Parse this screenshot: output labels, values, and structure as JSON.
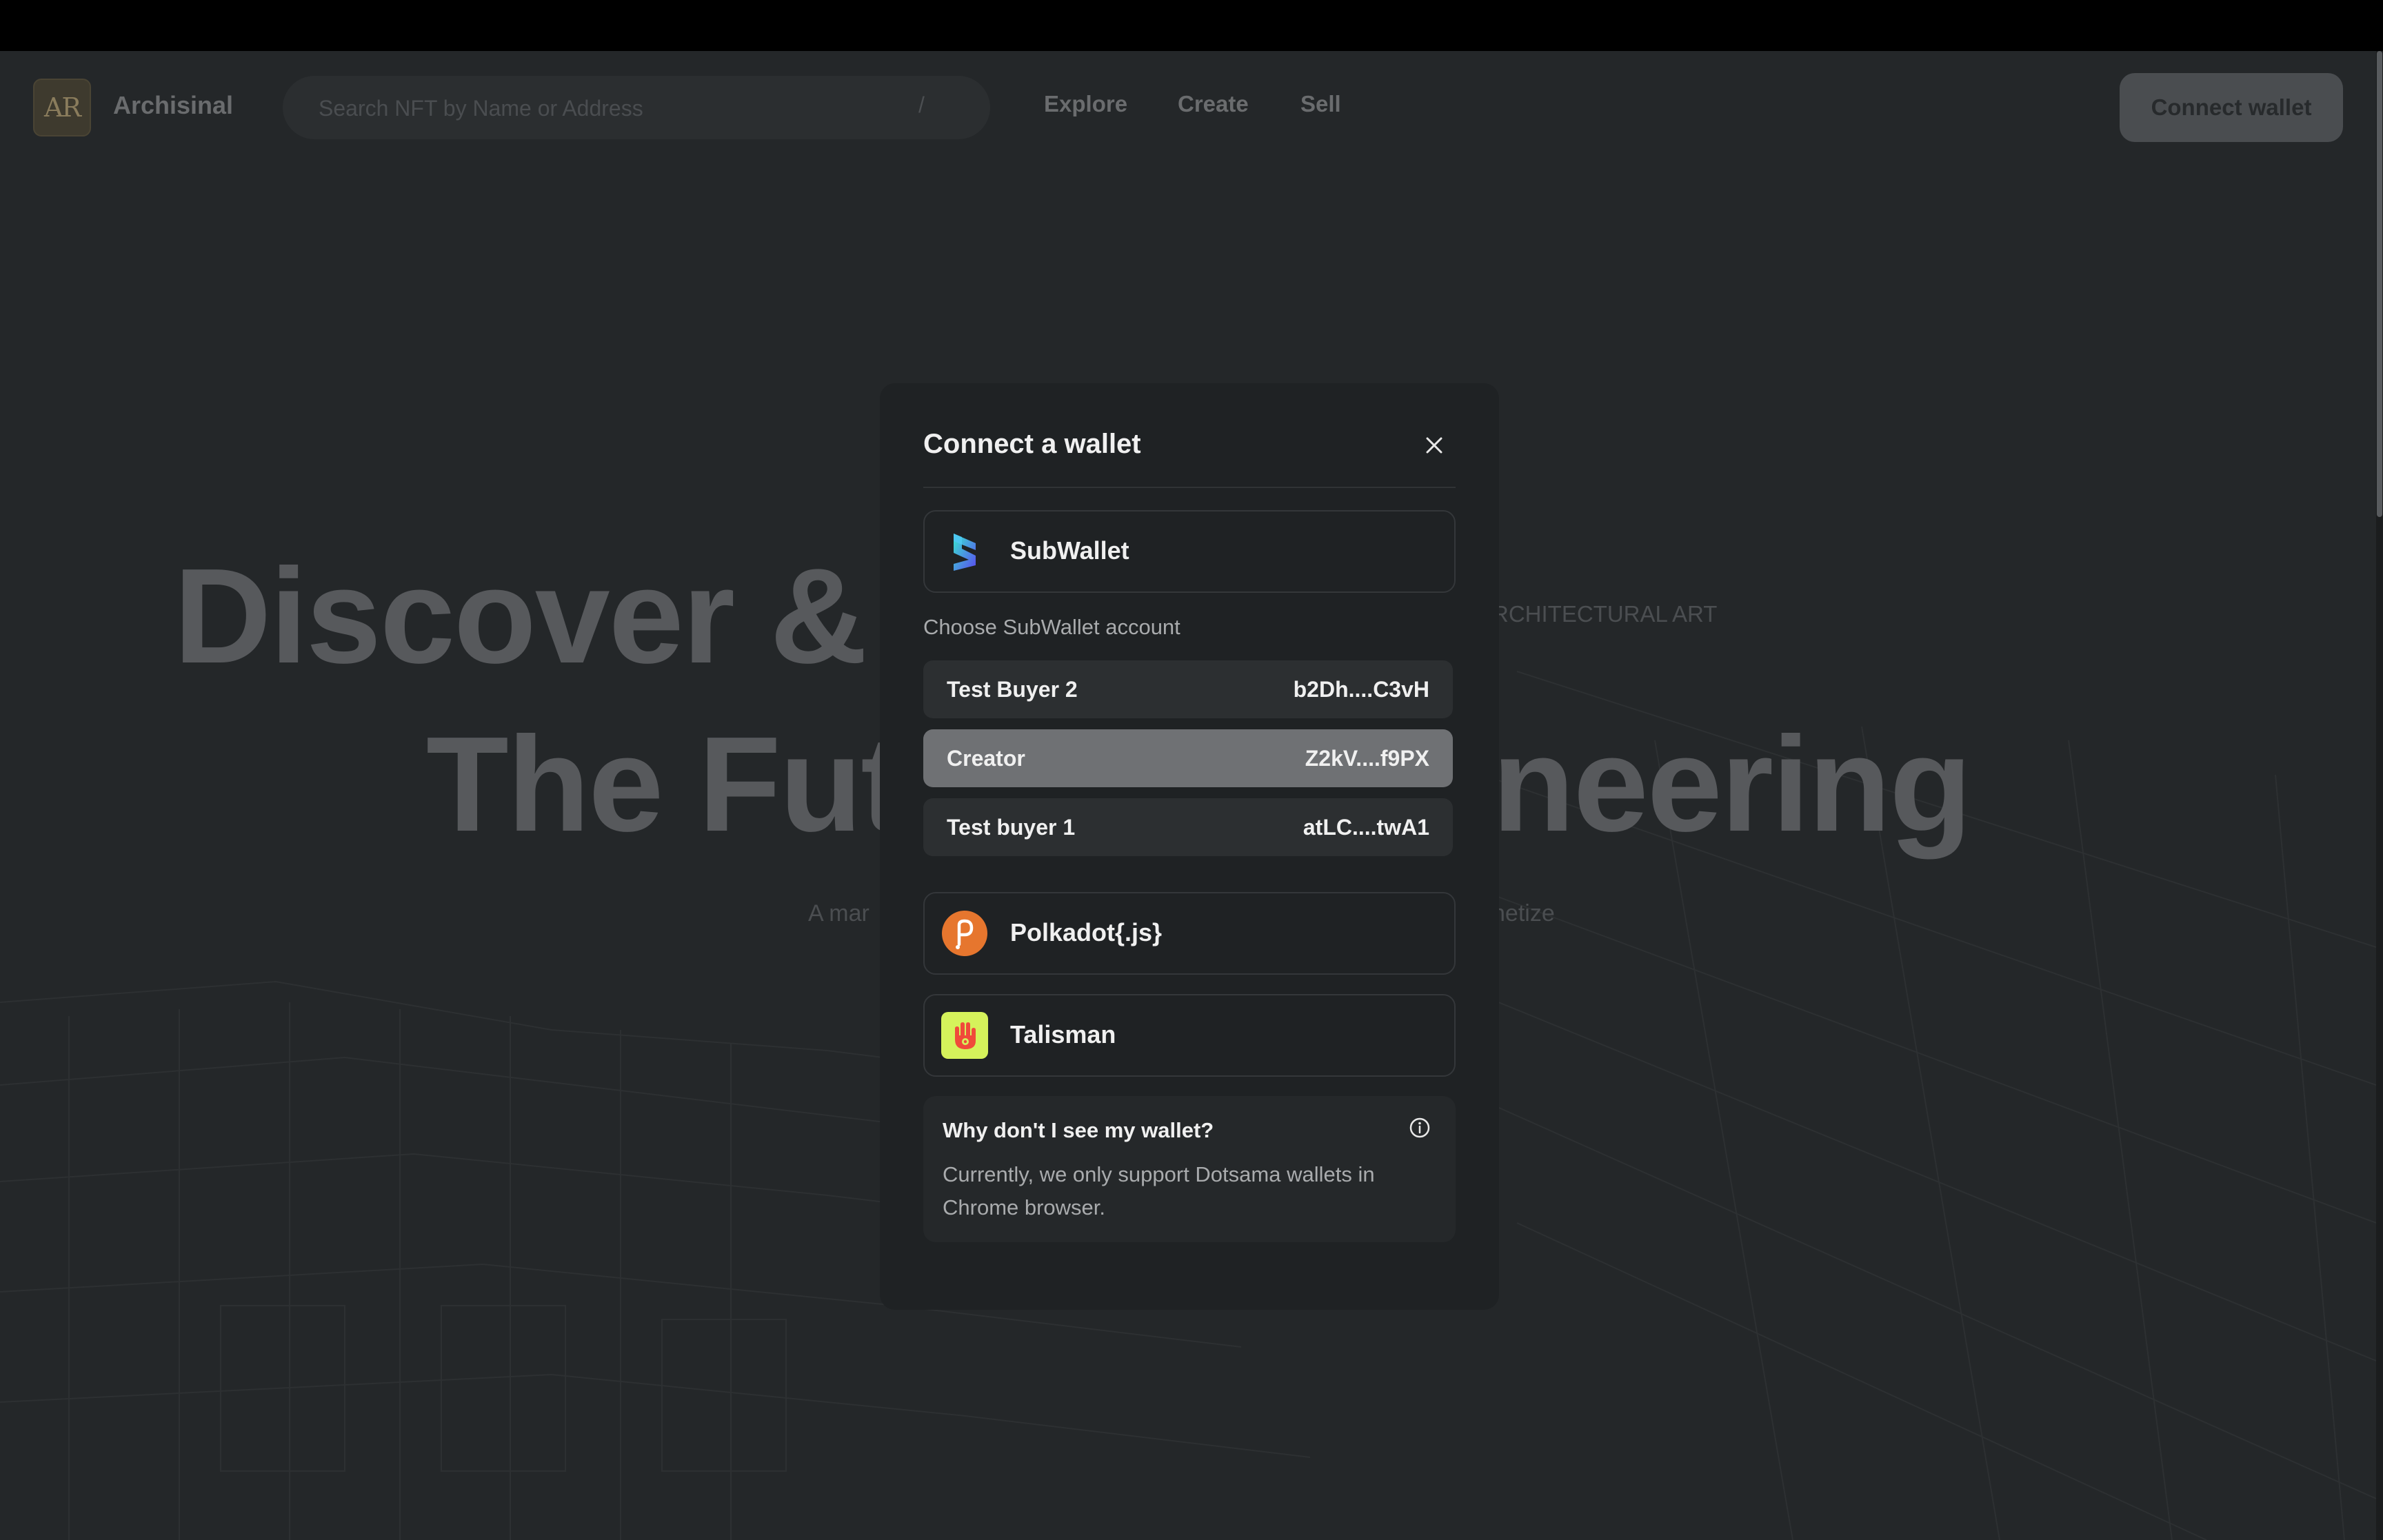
{
  "header": {
    "logo_text": "AR",
    "brand": "Archisinal",
    "search_placeholder": "Search NFT by Name or Address",
    "search_shortcut": "/",
    "nav": [
      "Explore",
      "Create",
      "Sell"
    ],
    "connect_button": "Connect wallet"
  },
  "hero": {
    "line1": "Discover & C",
    "line2a": "The Futu",
    "line2b": "neering",
    "tagline": "RCHITECTURAL ART",
    "subtitle_left": "A mar",
    "subtitle_right": "netize"
  },
  "modal": {
    "title": "Connect a wallet",
    "close_icon": "close-icon",
    "wallets": {
      "subwallet": {
        "name": "SubWallet",
        "icon": "subwallet-icon"
      },
      "polkadot": {
        "name": "Polkadot{.js}",
        "icon": "polkadot-icon"
      },
      "talisman": {
        "name": "Talisman",
        "icon": "talisman-icon"
      }
    },
    "accounts_label": "Choose SubWallet account",
    "accounts": [
      {
        "name": "Test Buyer 2",
        "address": "b2Dh....C3vH"
      },
      {
        "name": "Creator",
        "address": "Z2kV....f9PX",
        "selected": true
      },
      {
        "name": "Test buyer 1",
        "address": "atLC....twA1"
      }
    ],
    "info": {
      "question": "Why don't I see my wallet?",
      "description": "Currently, we only support Dotsama wallets in Chrome browser.",
      "icon": "info-icon"
    }
  },
  "colors": {
    "page_bg": "#242729",
    "modal_bg": "#1f2224",
    "selected_account": "#6f7174",
    "polkadot_orange": "#e6762e",
    "talisman_green": "#d5f25b"
  }
}
